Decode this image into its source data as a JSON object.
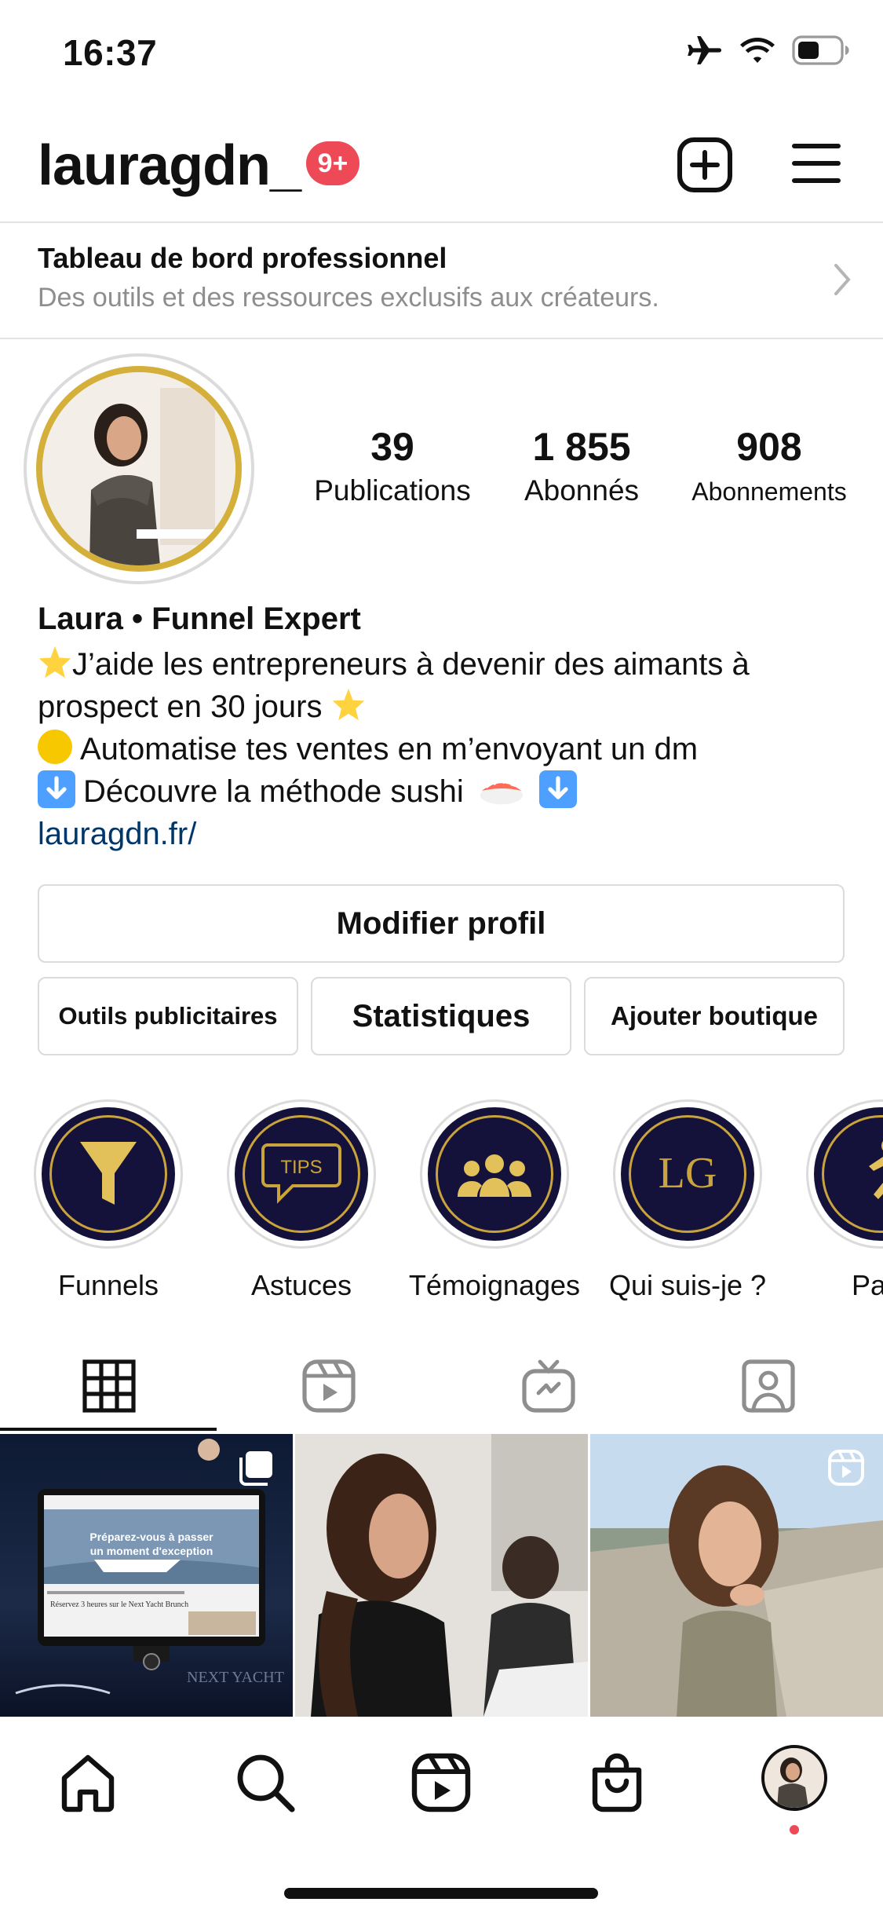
{
  "status_bar": {
    "time": "16:37",
    "icons": [
      "airplane-icon",
      "wifi-icon",
      "battery-icon"
    ]
  },
  "header": {
    "username": "lauragdn_",
    "notification_badge": "9+",
    "add_icon": "plus-square-icon",
    "menu_icon": "hamburger-menu-icon"
  },
  "pro_dashboard": {
    "title": "Tableau de bord professionnel",
    "subtitle": "Des outils et des ressources exclusifs aux créateurs."
  },
  "profile": {
    "stats": [
      {
        "value": "39",
        "label": "Publications"
      },
      {
        "value": "1 855",
        "label": "Abonnés"
      },
      {
        "value": "908",
        "label": "Abonnements"
      }
    ],
    "name": "Laura • Funnel Expert",
    "bio_lines": [
      "J’aide les entrepreneurs à devenir des aimants à",
      "prospect en 30 jours",
      "Automatise tes ventes en m’envoyant un dm",
      "Découvre la méthode sushi"
    ],
    "link": "lauragdn.fr/"
  },
  "buttons": {
    "edit_profile": "Modifier profil",
    "ad_tools": "Outils publicitaires",
    "statistics": "Statistiques",
    "add_shop": "Ajouter boutique"
  },
  "highlights": [
    {
      "label": "Funnels",
      "icon": "funnel-icon"
    },
    {
      "label": "Astuces",
      "icon": "tips-bubble-icon",
      "icon_text": "TIPS"
    },
    {
      "label": "Témoignages",
      "icon": "people-group-icon"
    },
    {
      "label": "Qui suis-je ?",
      "icon": "lg-monogram-icon",
      "icon_text": "LG"
    },
    {
      "label": "Parc",
      "icon": "runner-icon"
    }
  ],
  "tabs": [
    {
      "name": "grid",
      "icon": "grid-icon",
      "active": true
    },
    {
      "name": "reels",
      "icon": "reels-icon",
      "active": false
    },
    {
      "name": "igtv",
      "icon": "igtv-icon",
      "active": false
    },
    {
      "name": "tagged",
      "icon": "tagged-user-icon",
      "active": false
    }
  ],
  "posts": [
    {
      "type": "carousel",
      "icon": "carousel-icon",
      "caption_lines": [
        "Préparez-vous à passer",
        "un moment d'exception"
      ],
      "footer_text": "Réservez 3 heures sur le Next Yacht Brunch",
      "brand": "NEXT YACHT"
    },
    {
      "type": "photo"
    },
    {
      "type": "reel",
      "icon": "reels-icon"
    }
  ],
  "bottom_nav": [
    {
      "name": "home",
      "icon": "home-icon"
    },
    {
      "name": "search",
      "icon": "search-icon"
    },
    {
      "name": "reels",
      "icon": "reels-icon"
    },
    {
      "name": "shop",
      "icon": "shopping-bag-icon"
    },
    {
      "name": "profile",
      "icon": "profile-avatar"
    }
  ],
  "colors": {
    "badge_red": "#ed4956",
    "link_blue": "#00376b",
    "highlight_navy": "#14123b",
    "highlight_gold": "#c9a33b",
    "border_gray": "#dbdbdb"
  }
}
